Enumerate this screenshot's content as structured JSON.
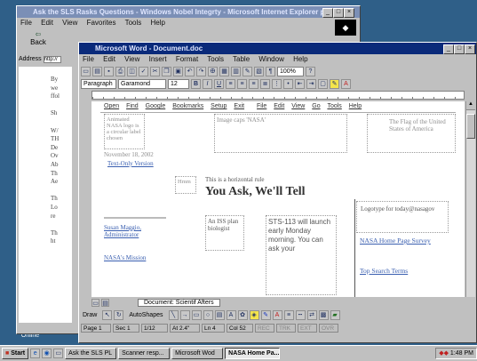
{
  "ie": {
    "title": "Ask the SLS Rasks Questions - Windows Nobel Integrty - Microsoft Internet Explorer pro",
    "menu": [
      "File",
      "Edit",
      "View",
      "Favorites",
      "Tools",
      "Help"
    ],
    "back": "Back",
    "address_label": "Address",
    "address_value": "http://",
    "left_snips": [
      "By",
      "we",
      "ffol",
      "",
      "Sh",
      "",
      "W/",
      "TH",
      "De",
      "Ov",
      "Ab",
      "Th",
      "Ae",
      "",
      "Th",
      "Lo",
      "re",
      "",
      "Th",
      "ht"
    ]
  },
  "word": {
    "title": "Microsoft Word - Document.doc",
    "menu": [
      "File",
      "Edit",
      "View",
      "Insert",
      "Format",
      "Tools",
      "Table",
      "Window",
      "Help"
    ],
    "style": "Paragraph",
    "font": "Garamond",
    "size": "12",
    "zoom": "100%",
    "browser_menu": [
      "Open",
      "Find",
      "Google",
      "Bookmarks",
      "Setup",
      "Exit",
      "File",
      "Edit",
      "View",
      "Go",
      "Tools",
      "Help"
    ],
    "content": {
      "logo_text": "Animated NASA logo is a circular label chosen",
      "date": "November 18, 2002",
      "text_only": "Text-Only Version",
      "image_cap": "Image caps 'NASA'",
      "flag": "The Flag of the United States of America",
      "hidden": "This is a horizontal rule",
      "head": "You Ask, We'll Tell",
      "small": "Hmm",
      "col1": "An ISS plan biologist",
      "col2": "STS-113 will launch early Monday morning. You can ask your",
      "mod1": "Susan Maggio, Administrator",
      "mod2": "NASA's Mission",
      "logo2": "Logotype for today@nasagov",
      "link1": "NASA Home Page Survey",
      "link2": "Top Search Terms"
    },
    "status_tab": "Document: Scientif Afters",
    "statusbar": [
      "Page 1",
      "Sec 1",
      "1/12",
      "At 2.4\"",
      "Ln 4",
      "Col 52",
      "REC",
      "TRK",
      "EXT",
      "OVR"
    ],
    "draw": "Draw",
    "autoshapes": "AutoShapes"
  },
  "desktop": {
    "icon_label": "Online"
  },
  "taskbar": {
    "start": "Start",
    "items": [
      "Ask the SLS PL",
      "Scanner resp...",
      "Microsoft Wod",
      "NASA Home Pa...",
      "",
      "1:48 PM"
    ]
  }
}
